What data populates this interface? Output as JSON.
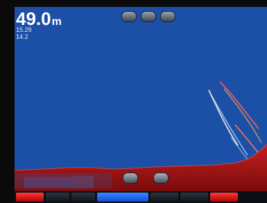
{
  "readout": {
    "depth_value": "49.0",
    "depth_unit": "m",
    "sub_line_1": "15.29",
    "sub_line_2": "14.2"
  },
  "top_controls": {
    "icons": [
      "zoom-out-icon",
      "center-icon",
      "zoom-in-icon"
    ]
  },
  "bottom_overlay": {
    "left_line_1": "",
    "left_line_2": "",
    "mid_line_1": "",
    "mid_line_2": ""
  },
  "toolbar": {
    "items": [
      {
        "label": "",
        "state": "alert"
      },
      {
        "label": "",
        "state": "normal"
      },
      {
        "label": "",
        "state": "normal"
      },
      {
        "label": "",
        "state": "selected"
      },
      {
        "label": "",
        "state": "normal"
      },
      {
        "label": "",
        "state": "normal"
      },
      {
        "label": "",
        "state": "alert"
      }
    ]
  },
  "colors": {
    "water": "#1c4fa6",
    "bottom_return": "#b51313",
    "marks": "#e83a3a",
    "alert": "#ff2b2b",
    "selected": "#2f7bff"
  }
}
